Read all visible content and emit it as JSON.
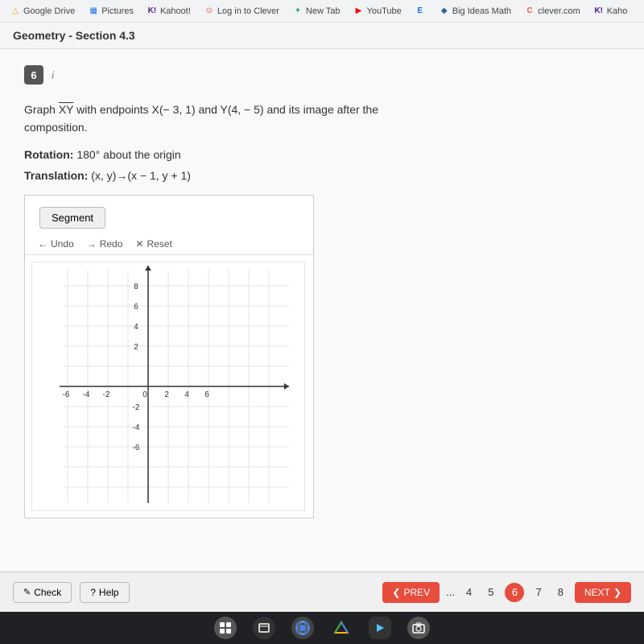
{
  "browser": {
    "bookmarks": [
      {
        "label": "Google Drive",
        "icon": "△",
        "color": "#f9ab00"
      },
      {
        "label": "Pictures",
        "icon": "▦",
        "color": "#1a73e8"
      },
      {
        "label": "Kahoot!",
        "icon": "K!",
        "color": "#46178f"
      },
      {
        "label": "Log in to Clever",
        "icon": "⊙",
        "color": "#f0583f"
      },
      {
        "label": "New Tab",
        "icon": "✦",
        "color": "#34a853"
      },
      {
        "label": "YouTube",
        "icon": "▶",
        "color": "#ff0000"
      },
      {
        "label": "E",
        "icon": "E",
        "color": "#1a73e8"
      },
      {
        "label": "Big Ideas Math",
        "icon": "◆",
        "color": "#2c5aa0"
      },
      {
        "label": "clever.com",
        "icon": "C",
        "color": "#f0583f"
      },
      {
        "label": "Kaho",
        "icon": "K!",
        "color": "#46178f"
      }
    ]
  },
  "page": {
    "title": "Geometry - Section 4.3",
    "question_number": "6",
    "info_label": "i",
    "question_text_1": "Graph ",
    "segment_label": "XY",
    "question_text_2": " with endpoints X(− 3, 1) and Y(4, − 5) and its image after the composition.",
    "rotation_label": "Rotation:",
    "rotation_value": "180° about the origin",
    "translation_label": "Translation:",
    "translation_value": "(x, y)→(x − 1, y + 1)"
  },
  "graph_tool": {
    "segment_button": "Segment",
    "undo_label": "Undo",
    "redo_label": "Redo",
    "reset_label": "Reset"
  },
  "footer": {
    "check_label": "Check",
    "help_label": "Help",
    "prev_label": "PREV",
    "next_label": "NEXT",
    "pages": [
      "4",
      "5",
      "6",
      "7",
      "8"
    ],
    "current_page": "6",
    "dots": "..."
  },
  "taskbar": {
    "icons": [
      "⊞",
      "⬛",
      "◉",
      "▲",
      "▶",
      "📷"
    ]
  }
}
